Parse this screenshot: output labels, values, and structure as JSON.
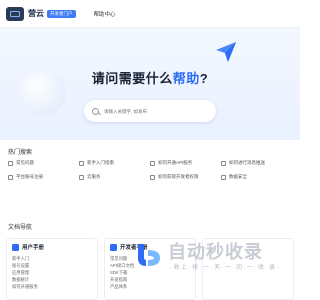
{
  "header": {
    "logo_text": "营云",
    "badge": "开发者门户",
    "nav_help": "帮助中心"
  },
  "hero": {
    "title_part1": "请问需要什么",
    "title_highlight": "帮助",
    "title_end": "?",
    "search_placeholder": "请输入关键字, 如发布"
  },
  "hot_search": {
    "title": "热门搜索",
    "items": [
      "常见问题",
      "新手入门指南",
      "如何开通API服务",
      "如何进行消息推送",
      "平台账号注册",
      "云服务",
      "如何获取开发者权限",
      "数据安全"
    ]
  },
  "docs": {
    "title": "文档导航",
    "cards": [
      {
        "title": "用户手册",
        "links": [
          "新手入门",
          "账号设置",
          "应用管理",
          "数据统计",
          "如何开通服务"
        ]
      },
      {
        "title": "开发者手册",
        "links": [
          "常见问题",
          "API接口文档",
          "SDK下载",
          "开发指南",
          "产品体系"
        ]
      },
      {
        "title": "",
        "links": []
      }
    ]
  },
  "watermark": {
    "text": "自动秒收录",
    "subtitle": "·收上·排·一·天·一·切·一·收·录·"
  },
  "colors": {
    "accent": "#2d6cf6",
    "hero_bg": "#eaf1ff",
    "text_dark": "#1a2335"
  }
}
